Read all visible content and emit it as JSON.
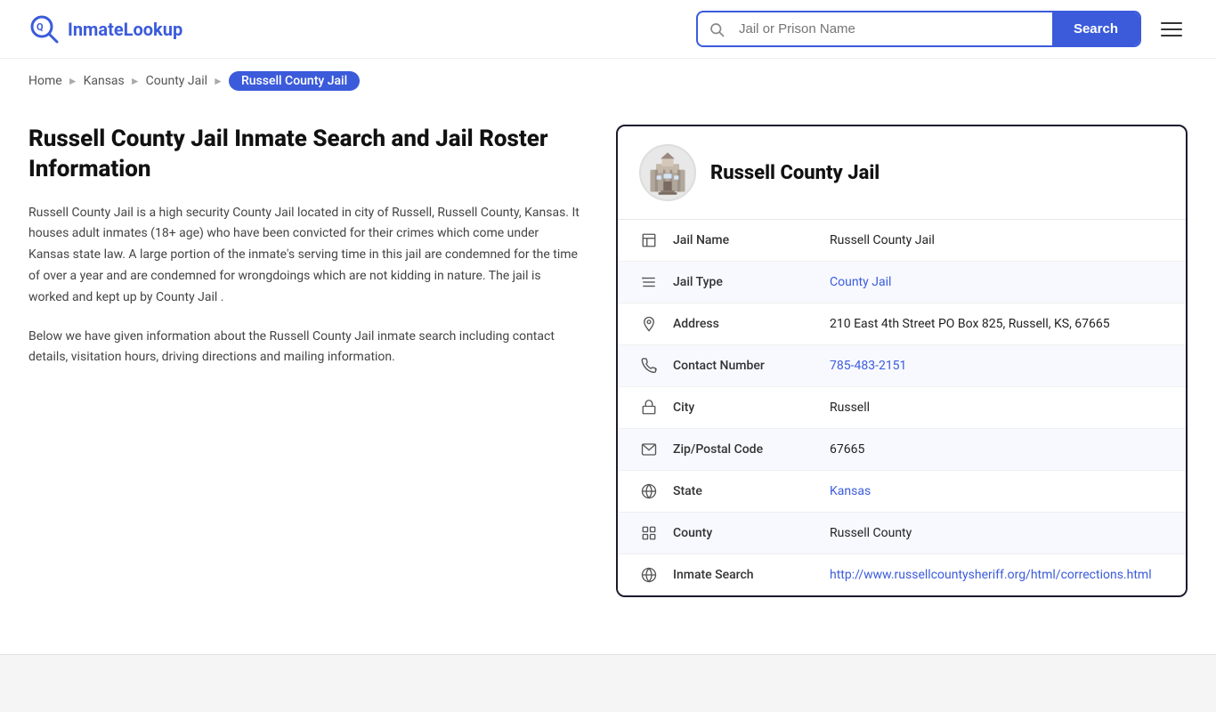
{
  "header": {
    "logo_text_part1": "Inmate",
    "logo_text_part2": "Lookup",
    "search_placeholder": "Jail or Prison Name",
    "search_button_label": "Search"
  },
  "breadcrumb": {
    "home": "Home",
    "kansas": "Kansas",
    "county_jail": "County Jail",
    "current": "Russell County Jail"
  },
  "left": {
    "title": "Russell County Jail Inmate Search and Jail Roster Information",
    "desc1": "Russell County Jail is a high security County Jail located in city of Russell, Russell County, Kansas. It houses adult inmates (18+ age) who have been convicted for their crimes which come under Kansas state law. A large portion of the inmate's serving time in this jail are condemned for the time of over a year and are condemned for wrongdoings which are not kidding in nature. The jail is worked and kept up by County Jail .",
    "desc2": "Below we have given information about the Russell County Jail inmate search including contact details, visitation hours, driving directions and mailing information."
  },
  "card": {
    "title": "Russell County Jail",
    "rows": [
      {
        "icon": "building-icon",
        "label": "Jail Name",
        "value": "Russell County Jail",
        "link": null
      },
      {
        "icon": "list-icon",
        "label": "Jail Type",
        "value": "County Jail",
        "link": "#"
      },
      {
        "icon": "location-icon",
        "label": "Address",
        "value": "210 East 4th Street PO Box 825, Russell, KS, 67665",
        "link": null
      },
      {
        "icon": "phone-icon",
        "label": "Contact Number",
        "value": "785-483-2151",
        "link": "tel:785-483-2151"
      },
      {
        "icon": "city-icon",
        "label": "City",
        "value": "Russell",
        "link": null
      },
      {
        "icon": "mail-icon",
        "label": "Zip/Postal Code",
        "value": "67665",
        "link": null
      },
      {
        "icon": "globe-icon",
        "label": "State",
        "value": "Kansas",
        "link": "#"
      },
      {
        "icon": "county-icon",
        "label": "County",
        "value": "Russell County",
        "link": null
      },
      {
        "icon": "search-globe-icon",
        "label": "Inmate Search",
        "value": "http://www.russellcountysheriff.org/html/corrections.html",
        "link": "http://www.russellcountysheriff.org/html/corrections.html"
      }
    ]
  }
}
